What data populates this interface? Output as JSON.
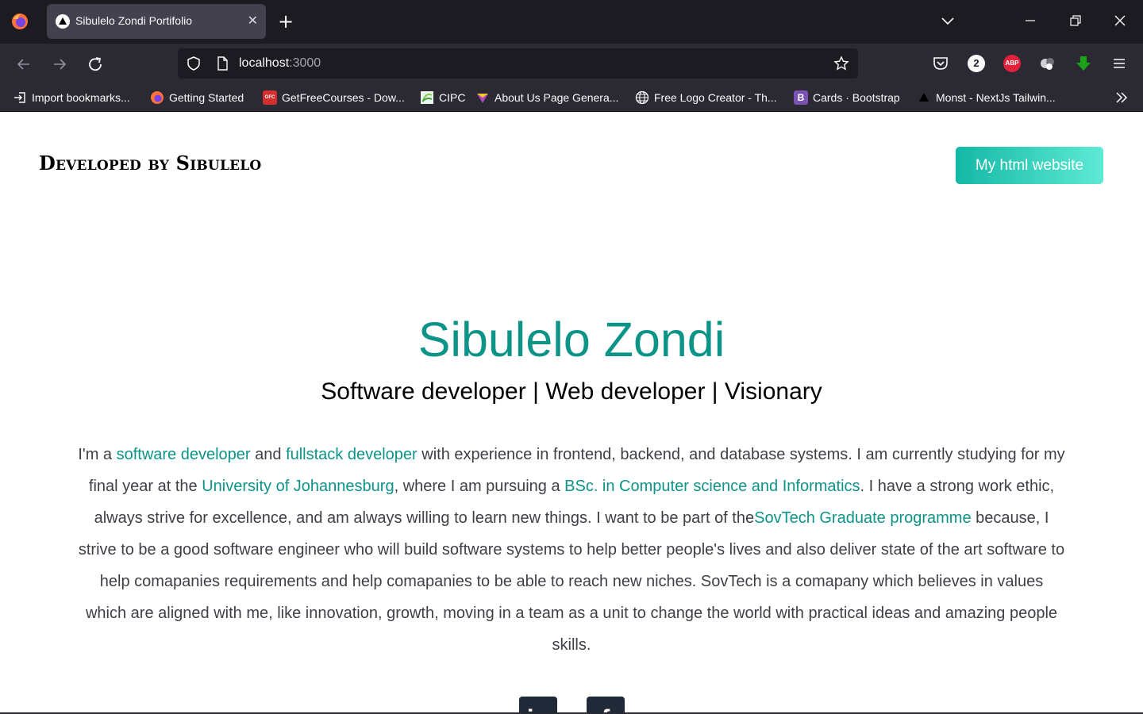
{
  "browser": {
    "tab_title": "Sibulelo Zondi Portifolio",
    "url_host": "localhost",
    "url_port": ":3000",
    "badge_count": "2",
    "abp_label": "ABP",
    "bookmarks": [
      {
        "label": "Import bookmarks...",
        "icon": "import-icon",
        "color": "#2b2a33"
      },
      {
        "label": "Getting Started",
        "icon": "firefox-icon",
        "color": "#ff7139"
      },
      {
        "label": "GetFreeCourses - Dow...",
        "icon": "gfc-icon",
        "color": "#d32f2f",
        "icon_text": "GFC"
      },
      {
        "label": "CIPC",
        "icon": "cipc-icon",
        "color": "#8bc34a"
      },
      {
        "label": "About Us Page Genera...",
        "icon": "heart-logo-icon",
        "color": "#9c27b0"
      },
      {
        "label": "Free Logo Creator - Th...",
        "icon": "globe-icon",
        "color": "#2b2a33"
      },
      {
        "label": "Cards · Bootstrap",
        "icon": "bootstrap-icon",
        "color": "#7952b3",
        "icon_text": "B"
      },
      {
        "label": "Monst - NextJs Tailwin...",
        "icon": "triangle-icon",
        "color": "#000000"
      }
    ]
  },
  "page": {
    "brand": "Developed by Sibulelo",
    "cta_label": "My html website",
    "name": "Sibulelo Zondi",
    "subtitle": "Software developer | Web developer | Visionary",
    "bio": {
      "t1": "I'm a ",
      "l1": "software developer",
      "t2": " and ",
      "l2": "fullstack developer",
      "t3": " with experience in frontend, backend, and database systems. I am currently studying for my final year at the ",
      "l3": "University of Johannesburg",
      "t4": ", where I am pursuing a ",
      "l4": "BSc. in Computer science and Informatics",
      "t5": ". I have a strong work ethic, always strive for excellence, and am always willing to learn new things. I want to be part of the",
      "l5": "SovTech Graduate programme",
      "t6": " because, I strive to be a good software engineer who will build software systems to help better people's lives and also deliver state of the art software to help comapanies requirements and help comapanies to be able to reach new niches. SovTech is a comapany which believes in values which are aligned with me, like innovation, growth, moving in a team as a unit to change the world with practical ideas and amazing people skills."
    },
    "social": [
      {
        "name": "linkedin-icon",
        "glyph": "in"
      },
      {
        "name": "facebook-icon",
        "glyph": "f"
      }
    ]
  },
  "colors": {
    "accent": "#0d9488",
    "cta_gradient_start": "#14b8a6",
    "cta_gradient_end": "#5eead4"
  }
}
